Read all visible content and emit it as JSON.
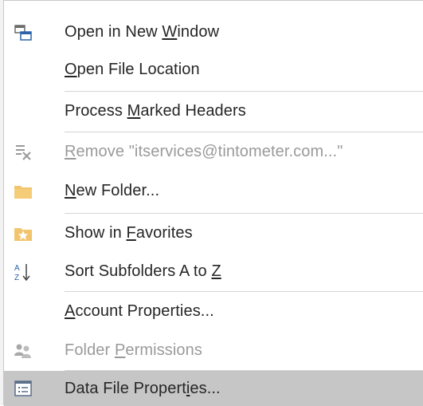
{
  "menu": {
    "items": [
      {
        "pre": "Open in New ",
        "key": "W",
        "post": "indow",
        "icon": "open-new-window-icon",
        "enabled": true
      },
      {
        "pre": "",
        "key": "O",
        "post": "pen File Location",
        "icon": "",
        "enabled": true
      },
      {
        "pre": "Process ",
        "key": "M",
        "post": "arked Headers",
        "icon": "",
        "enabled": true
      },
      {
        "pre": "",
        "key": "R",
        "post": "emove \"itservices@tintometer.com...\"",
        "icon": "remove-filter-icon",
        "enabled": false
      },
      {
        "pre": "",
        "key": "N",
        "post": "ew Folder...",
        "icon": "folder-icon",
        "enabled": true
      },
      {
        "pre": "Show in ",
        "key": "F",
        "post": "avorites",
        "icon": "favorite-folder-icon",
        "enabled": true
      },
      {
        "pre": "Sort Subfolders A to ",
        "key": "Z",
        "post": "",
        "icon": "sort-a-to-z-icon",
        "enabled": true
      },
      {
        "pre": "",
        "key": "A",
        "post": "ccount Properties...",
        "icon": "",
        "enabled": true
      },
      {
        "pre": "Folder ",
        "key": "P",
        "post": "ermissions",
        "icon": "folder-permissions-icon",
        "enabled": false
      },
      {
        "pre": "Data File Propert",
        "key": "i",
        "post": "es...",
        "icon": "data-file-properties-icon",
        "enabled": true,
        "highlighted": true
      }
    ]
  }
}
